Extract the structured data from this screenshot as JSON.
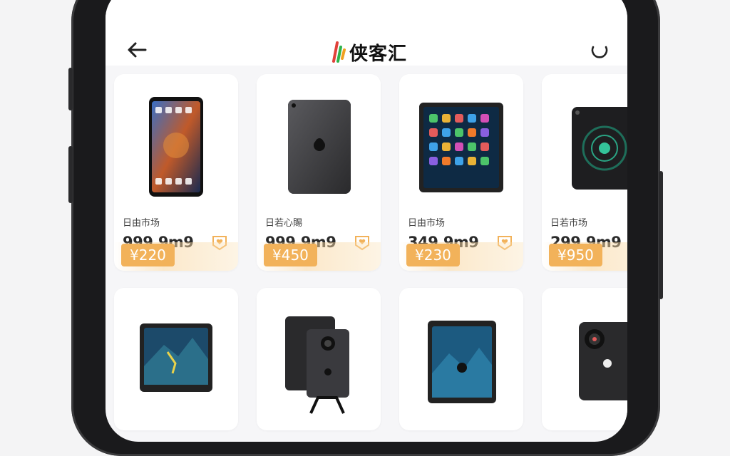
{
  "header": {
    "brand_name": "侠客汇"
  },
  "products": [
    {
      "tag": "日由市场",
      "old_price": "999.9m9",
      "price": "¥220",
      "device": "phone"
    },
    {
      "tag": "日若心賜",
      "old_price": "999.9m9",
      "price": "¥450",
      "device": "tablet-back"
    },
    {
      "tag": "日由市场",
      "old_price": "349.9m9",
      "price": "¥230",
      "device": "tablet-apps"
    },
    {
      "tag": "日若市场",
      "old_price": "299.9m9",
      "price": "¥950",
      "device": "tablet-dark"
    },
    {
      "device": "tablet-landscape"
    },
    {
      "device": "tablet-stand"
    },
    {
      "device": "tablet-blue"
    },
    {
      "device": "phone-camera"
    }
  ],
  "colors": {
    "accent": "#f2b25a",
    "background": "#f6f6f8",
    "card": "#ffffff",
    "frame": "#1a1a1c"
  },
  "icons": {
    "back": "arrow-left-icon",
    "refresh": "refresh-icon",
    "favorite": "tag-heart-icon",
    "logo": "brand-logo-icon"
  }
}
